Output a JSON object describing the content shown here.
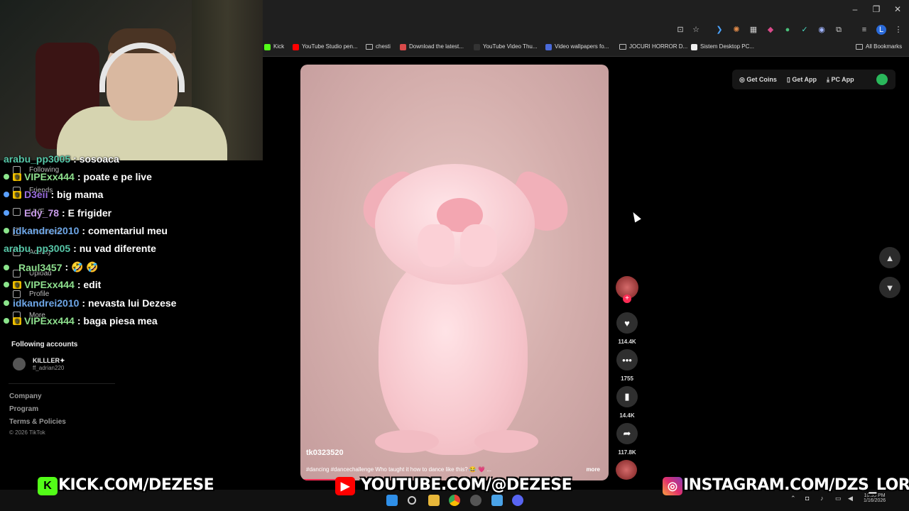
{
  "browser": {
    "bookmarks": [
      {
        "label": "Kick",
        "color": "#53fc18"
      },
      {
        "label": "YouTube Studio pen...",
        "color": "#ff0000"
      },
      {
        "label": "chesti",
        "folder": true
      },
      {
        "label": "Download the latest...",
        "color": "#d94a4a"
      },
      {
        "label": "YouTube Video Thu...",
        "color": "#111111"
      },
      {
        "label": "Video wallpapers fo...",
        "color": "#4a6ad9"
      },
      {
        "label": "JOCURI HORROR D...",
        "folder": true
      },
      {
        "label": "Sistem Desktop PC...",
        "color": "#eeeeee"
      }
    ],
    "all_bookmarks": "All Bookmarks",
    "profile_initial": "L"
  },
  "sidebar": {
    "nav": [
      "Following",
      "Friends",
      "LIVE",
      "Messages",
      "Activity",
      "Upload",
      "Profile",
      "More"
    ],
    "following_title": "Following accounts",
    "account": {
      "name": "KILLLER✦",
      "handle": "ff_adrian220"
    },
    "footer": [
      "Company",
      "Program",
      "Terms & Policies"
    ],
    "copyright": "© 2026 TikTok"
  },
  "chat": [
    {
      "user": "arabu_pp3005",
      "msg": ": sosoaca",
      "color": "#57c7a8",
      "badge": false,
      "crown": false
    },
    {
      "user": "VIPExx444",
      "msg": ": poate e pe live",
      "color": "#8ee08e",
      "badge": true,
      "crown": true
    },
    {
      "user": "D3eii",
      "msg": ": big mama",
      "color": "#9b6ee0",
      "badge": true,
      "crown": true
    },
    {
      "user": "Edy_78",
      "msg": ": E frigider",
      "color": "#c79be8",
      "badge": true,
      "crown": false
    },
    {
      "user": "idkandrei2010",
      "msg": ": comentariul meu",
      "color": "#6ea7e8",
      "badge": true,
      "crown": false
    },
    {
      "user": "arabu_pp3005",
      "msg": ": nu vad diferente",
      "color": "#57c7a8",
      "badge": false,
      "crown": false
    },
    {
      "user": "Raul3457",
      "msg": ": 🤣 🤣",
      "color": "#8ee08e",
      "badge": true,
      "crown": false
    },
    {
      "user": "VIPExx444",
      "msg": ": edit",
      "color": "#8ee08e",
      "badge": true,
      "crown": true
    },
    {
      "user": "idkandrei2010",
      "msg": ": nevasta lui Dezese",
      "color": "#6ea7e8",
      "badge": true,
      "crown": false
    },
    {
      "user": "VIPExx444",
      "msg": ": baga piesa mea",
      "color": "#8ee08e",
      "badge": true,
      "crown": true
    }
  ],
  "video": {
    "username": "tk0323520",
    "caption": "#dancing  #dancechallenge  Who taught it how to dance like this? 😂 💗 ...",
    "more": "more",
    "progress": 0.12
  },
  "actions": {
    "likes": "114.4K",
    "comments": "1755",
    "saves": "14.4K",
    "shares": "117.8K"
  },
  "header": {
    "get_coins": "Get Coins",
    "get_app": "Get App",
    "pc_app": "PC App"
  },
  "banners": {
    "kick": "KICK.COM/DEZESE",
    "youtube": "YOUTUBE.COM/@DEZESE",
    "instagram": "INSTAGRAM.COM/DZS_LORI"
  },
  "taskbar": {
    "time": "10:35 PM",
    "date": "1/16/2026"
  }
}
